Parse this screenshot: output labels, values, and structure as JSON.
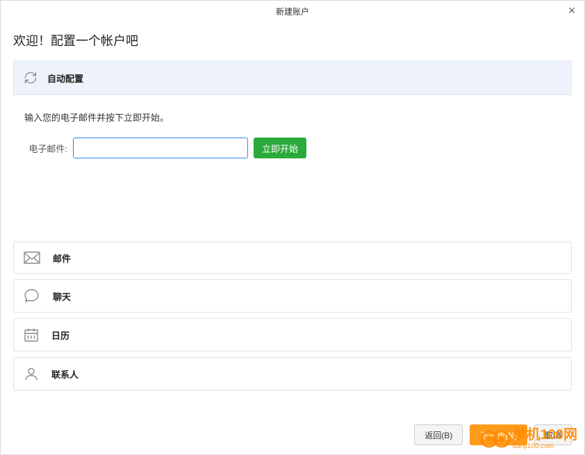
{
  "titlebar": {
    "title": "新建账户"
  },
  "welcome": "欢迎！配置一个帐户吧",
  "autoconfig": {
    "label": "自动配置"
  },
  "instruction": "输入您的电子邮件并按下立即开始。",
  "email": {
    "label": "电子邮件:",
    "value": "",
    "start_button": "立即开始"
  },
  "services": [
    {
      "id": "mail",
      "label": "邮件"
    },
    {
      "id": "chat",
      "label": "聊天"
    },
    {
      "id": "calendar",
      "label": "日历"
    },
    {
      "id": "contacts",
      "label": "联系人"
    }
  ],
  "footer": {
    "back": "返回(B)",
    "next": "下一步(N)",
    "cancel": "取消"
  },
  "watermark": {
    "brand": "单机100网",
    "domain": "danji100.com"
  },
  "colors": {
    "accent_green": "#2aaa3a",
    "accent_orange": "#ff9b1a",
    "input_border": "#2489f0",
    "panel_bg": "#eef3fb"
  }
}
